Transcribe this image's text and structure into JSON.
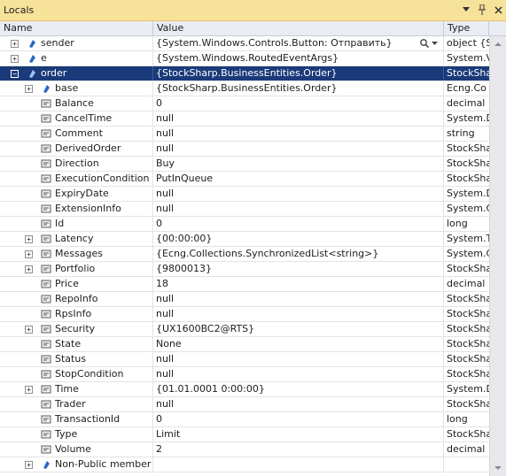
{
  "panel": {
    "title": "Locals",
    "buttons": [
      {
        "name": "window-position-dropdown-icon",
        "glyph": "▾"
      },
      {
        "name": "pin-icon",
        "glyph": "📌"
      },
      {
        "name": "close-icon",
        "glyph": "✕"
      }
    ]
  },
  "columns": {
    "name": "Name",
    "value": "Value",
    "type": "Type"
  },
  "rows": [
    {
      "name": "sender",
      "value": "{System.Windows.Controls.Button: Отправить}",
      "type": "object {S",
      "level": 0,
      "expander": "+",
      "icon": "field",
      "magnifier": true
    },
    {
      "name": "e",
      "value": "{System.Windows.RoutedEventArgs}",
      "type": "System.V",
      "level": 0,
      "expander": "+",
      "icon": "field"
    },
    {
      "name": "order",
      "value": "{StockSharp.BusinessEntities.Order}",
      "type": "StockSha",
      "level": 0,
      "expander": "−",
      "icon": "field",
      "selected": true
    },
    {
      "name": "base",
      "value": "{StockSharp.BusinessEntities.Order}",
      "type": "Ecng.Co",
      "level": 1,
      "expander": "+",
      "icon": "field"
    },
    {
      "name": "Balance",
      "value": "0",
      "type": "decimal",
      "level": 1,
      "icon": "property"
    },
    {
      "name": "CancelTime",
      "value": "null",
      "type": "System.D",
      "level": 1,
      "icon": "property"
    },
    {
      "name": "Comment",
      "value": "null",
      "type": "string",
      "level": 1,
      "icon": "property"
    },
    {
      "name": "DerivedOrder",
      "value": "null",
      "type": "StockSha",
      "level": 1,
      "icon": "property"
    },
    {
      "name": "Direction",
      "value": "Buy",
      "type": "StockSha",
      "level": 1,
      "icon": "property"
    },
    {
      "name": "ExecutionCondition",
      "value": "PutInQueue",
      "type": "StockSha",
      "level": 1,
      "icon": "property"
    },
    {
      "name": "ExpiryDate",
      "value": "null",
      "type": "System.D",
      "level": 1,
      "icon": "property"
    },
    {
      "name": "ExtensionInfo",
      "value": "null",
      "type": "System.C",
      "level": 1,
      "icon": "property"
    },
    {
      "name": "Id",
      "value": "0",
      "type": "long",
      "level": 1,
      "icon": "property"
    },
    {
      "name": "Latency",
      "value": "{00:00:00}",
      "type": "System.T",
      "level": 1,
      "expander": "+",
      "icon": "property"
    },
    {
      "name": "Messages",
      "value": "{Ecng.Collections.SynchronizedList<string>}",
      "type": "System.C",
      "level": 1,
      "expander": "+",
      "icon": "property"
    },
    {
      "name": "Portfolio",
      "value": "{9800013}",
      "type": "StockSha",
      "level": 1,
      "expander": "+",
      "icon": "property"
    },
    {
      "name": "Price",
      "value": "18",
      "type": "decimal",
      "level": 1,
      "icon": "property"
    },
    {
      "name": "RepoInfo",
      "value": "null",
      "type": "StockSha",
      "level": 1,
      "icon": "property"
    },
    {
      "name": "RpsInfo",
      "value": "null",
      "type": "StockSha",
      "level": 1,
      "icon": "property"
    },
    {
      "name": "Security",
      "value": "{UX1600BC2@RTS}",
      "type": "StockSha",
      "level": 1,
      "expander": "+",
      "icon": "property"
    },
    {
      "name": "State",
      "value": "None",
      "type": "StockSha",
      "level": 1,
      "icon": "property"
    },
    {
      "name": "Status",
      "value": "null",
      "type": "StockSha",
      "level": 1,
      "icon": "property"
    },
    {
      "name": "StopCondition",
      "value": "null",
      "type": "StockSha",
      "level": 1,
      "icon": "property"
    },
    {
      "name": "Time",
      "value": "{01.01.0001 0:00:00}",
      "type": "System.D",
      "level": 1,
      "expander": "+",
      "icon": "property"
    },
    {
      "name": "Trader",
      "value": "null",
      "type": "StockSha",
      "level": 1,
      "icon": "property"
    },
    {
      "name": "TransactionId",
      "value": "0",
      "type": "long",
      "level": 1,
      "icon": "property"
    },
    {
      "name": "Type",
      "value": "Limit",
      "type": "StockSha",
      "level": 1,
      "icon": "property"
    },
    {
      "name": "Volume",
      "value": "2",
      "type": "decimal",
      "level": 1,
      "icon": "property"
    },
    {
      "name": "Non-Public member",
      "value": "",
      "type": "",
      "level": 1,
      "expander": "+",
      "icon": "group"
    }
  ],
  "colors": {
    "titlebar": "#f7e29a",
    "selection": "#1b3a7a",
    "field_icon": "#2a66c6",
    "property_icon": "#5a5a5a"
  }
}
